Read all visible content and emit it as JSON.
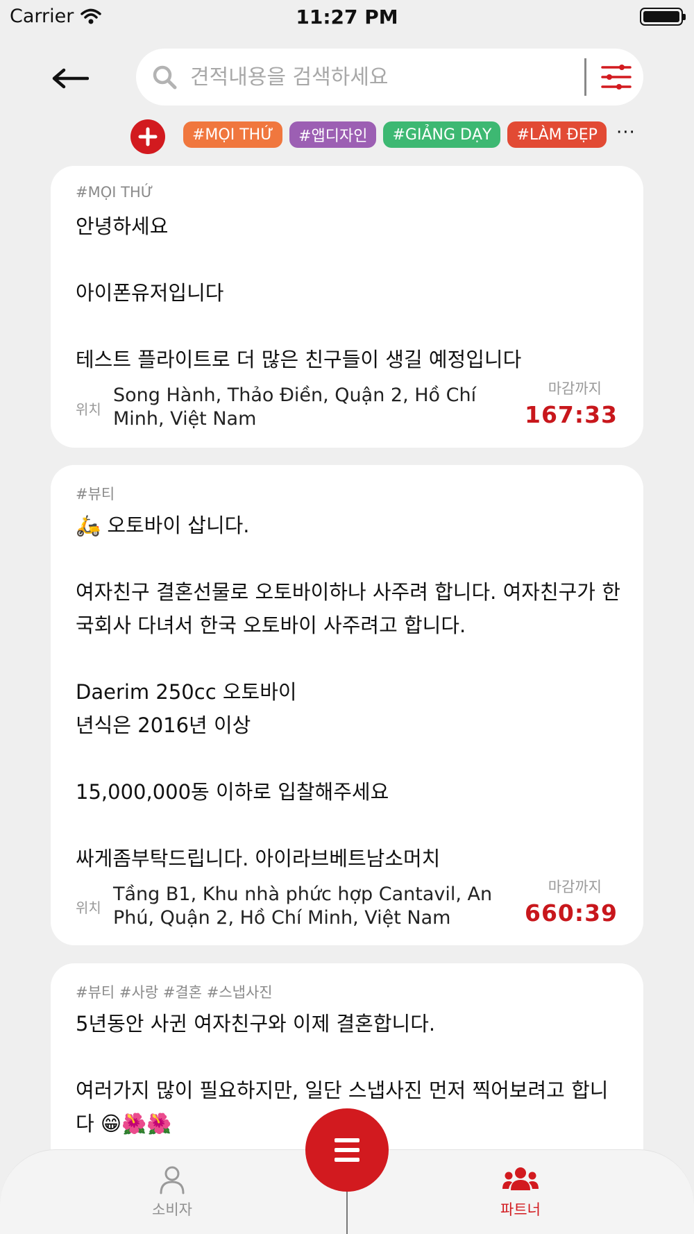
{
  "status_bar": {
    "carrier": "Carrier",
    "time": "11:27 PM"
  },
  "search": {
    "placeholder": "견적내용을 검색하세요"
  },
  "icons": {
    "back": "arrow-left-icon",
    "search": "magnifier-icon",
    "filter": "sliders-icon",
    "add": "plus-icon",
    "fab": "menu-lines-icon"
  },
  "colors": {
    "brand_red": "#d21a1f",
    "deadline_red": "#c8171c"
  },
  "categories": [
    {
      "label": "#MỌI THỨ",
      "color": "#f0773e"
    },
    {
      "label": "#앱디자인",
      "color": "#9c5fb3"
    },
    {
      "label": "#GIẢNG DẠY",
      "color": "#3db872"
    },
    {
      "label": "#LÀM ĐẸP",
      "color": "#e24a34"
    }
  ],
  "more_label": "···",
  "cards": [
    {
      "tags": "#MỌI THỨ",
      "body": "안녕하세요\n\n아이폰유저입니다\n\n테스트 플라이트로 더 많은 친구들이 생길 예정입니다",
      "location_label": "위치",
      "location": "Song Hành, Thảo Điền, Quận 2, Hồ Chí Minh, Việt Nam",
      "deadline_label": "마감까지",
      "deadline": "167:33"
    },
    {
      "tags": "#뷰티",
      "body": "🛵 오토바이 삽니다.\n\n여자친구 결혼선물로 오토바이하나 사주려 합니다. 여자친구가 한국회사 다녀서 한국 오토바이 사주려고 합니다.\n\nDaerim 250cc 오토바이\n년식은 2016년 이상\n\n15,000,000동 이하로 입찰해주세요\n\n싸게좀부탁드립니다. 아이라브베트남소머치",
      "location_label": "위치",
      "location": "Tầng B1, Khu nhà phức hợp Cantavil, An Phú, Quận 2, Hồ Chí Minh, Việt Nam",
      "deadline_label": "마감까지",
      "deadline": "660:39"
    },
    {
      "tags": "#뷰티 #사랑 #결혼 #스냅사진",
      "body": "5년동안 사귄 여자친구와 이제 결혼합니다.\n\n여러가지 많이 필요하지만, 일단 스냅사진 먼저 찍어보려고 합니다 😁🌺🌺"
    }
  ],
  "tabs": {
    "consumer": "소비자",
    "partner": "파트너"
  }
}
